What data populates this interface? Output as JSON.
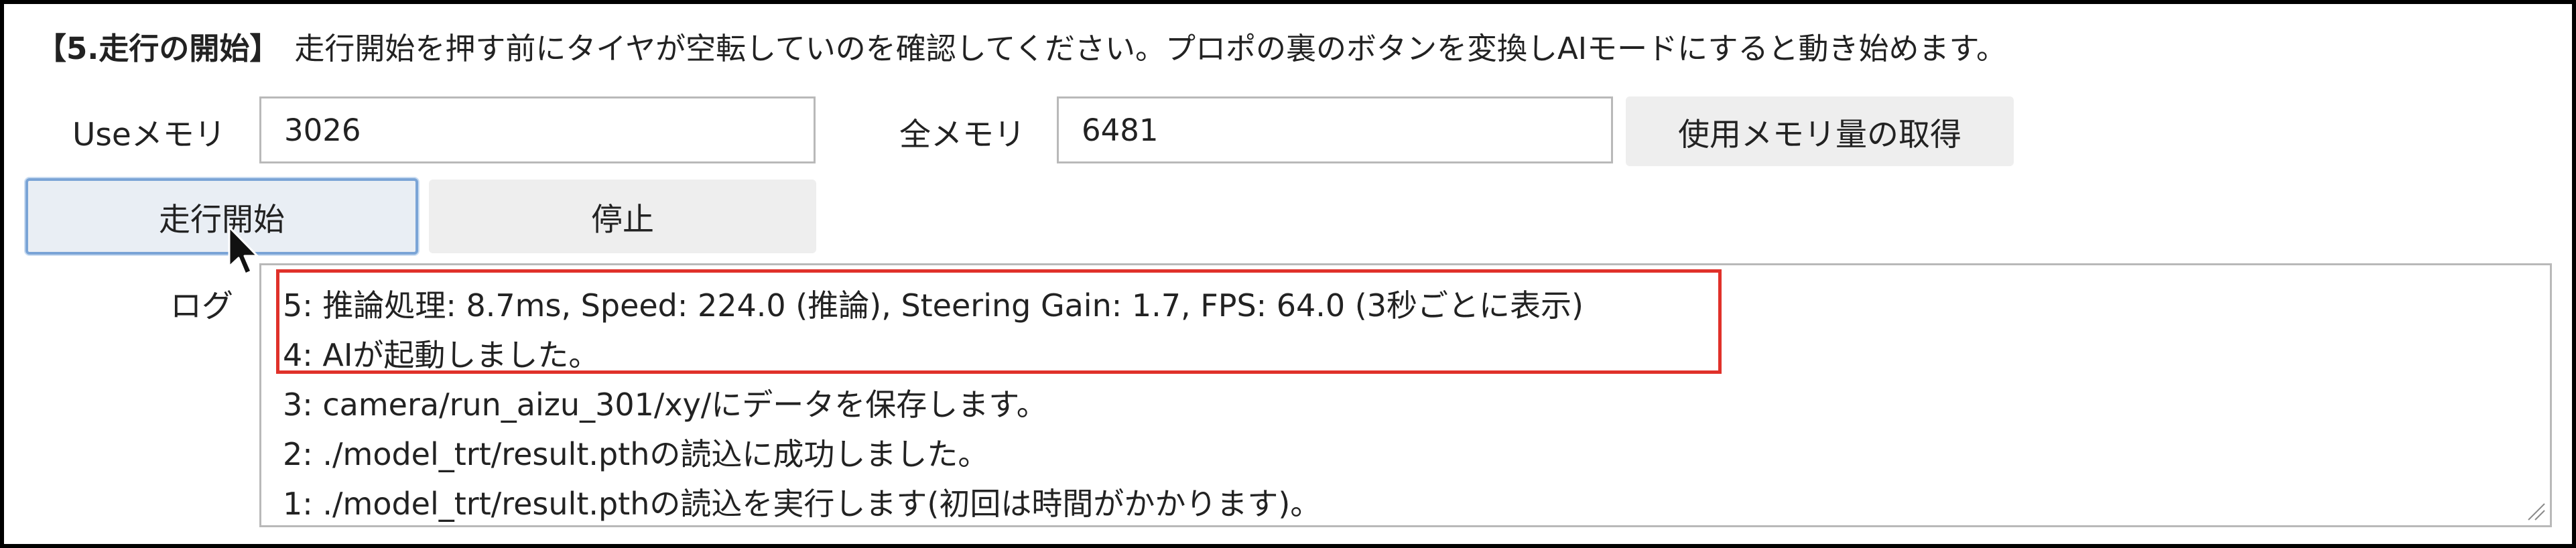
{
  "heading": {
    "section_title": "【5.走行の開始】",
    "instruction": "走行開始を押す前にタイヤが空転していのを確認してください。プロポの裏のボタンを変換しAIモードにすると動き始めます。"
  },
  "memory": {
    "use_label": "Useメモリ",
    "use_value": "3026",
    "total_label": "全メモリ",
    "total_value": "6481",
    "fetch_button": "使用メモリ量の取得"
  },
  "controls": {
    "start_button": "走行開始",
    "stop_button": "停止"
  },
  "log": {
    "label": "ログ",
    "lines": [
      "5: 推論処理: 8.7ms, Speed: 224.0 (推論), Steering Gain: 1.7, FPS: 64.0 (3秒ごとに表示)",
      "4: AIが起動しました。",
      "3: camera/run_aizu_301/xy/にデータを保存します。",
      "2: ./model_trt/result.pthの読込に成功しました。",
      "1: ./model_trt/result.pthの読込を実行します(初回は時間がかかります)。"
    ]
  },
  "colors": {
    "highlight": "#e0312a",
    "focus_ring": "#7aa4d6",
    "button_bg": "#eeeeee"
  },
  "icons": {
    "cursor": "mouse-pointer-icon",
    "grip": "resize-grip-icon"
  }
}
